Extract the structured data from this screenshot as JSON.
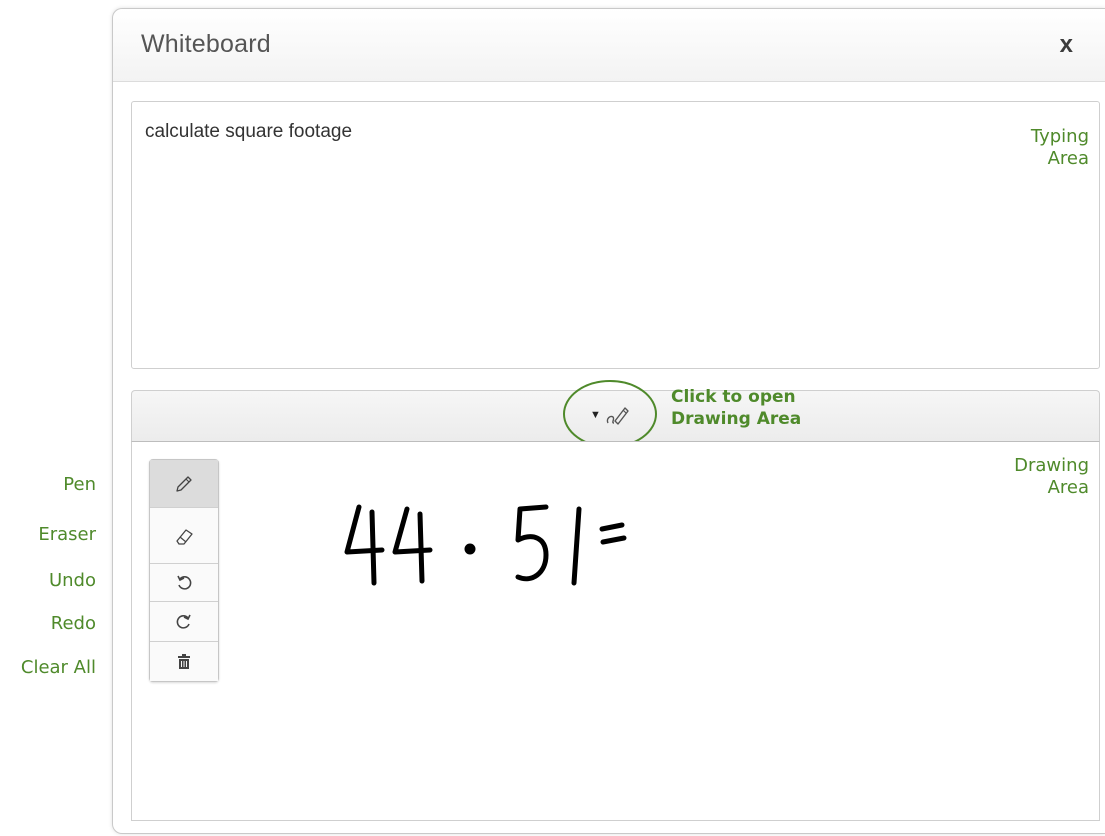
{
  "window": {
    "title": "Whiteboard",
    "close_label": "x"
  },
  "typing": {
    "text": "calculate square footage"
  },
  "annotations": {
    "typing_area": [
      "Typing",
      "Area"
    ],
    "drawing_area": [
      "Drawing",
      "Area"
    ],
    "toggle_hint": [
      "Click to open",
      "Drawing Area"
    ]
  },
  "tools": [
    {
      "label": "Pen",
      "icon": "pencil-icon",
      "active": true
    },
    {
      "label": "Eraser",
      "icon": "eraser-icon",
      "active": false
    },
    {
      "label": "Undo",
      "icon": "undo-icon",
      "active": false
    },
    {
      "label": "Redo",
      "icon": "redo-icon",
      "active": false
    },
    {
      "label": "Clear All",
      "icon": "trash-icon",
      "active": false
    }
  ],
  "drawing": {
    "handwritten_text": "44 · 51 ="
  },
  "colors": {
    "annotation": "#4f8a2b",
    "ink": "#000000"
  }
}
